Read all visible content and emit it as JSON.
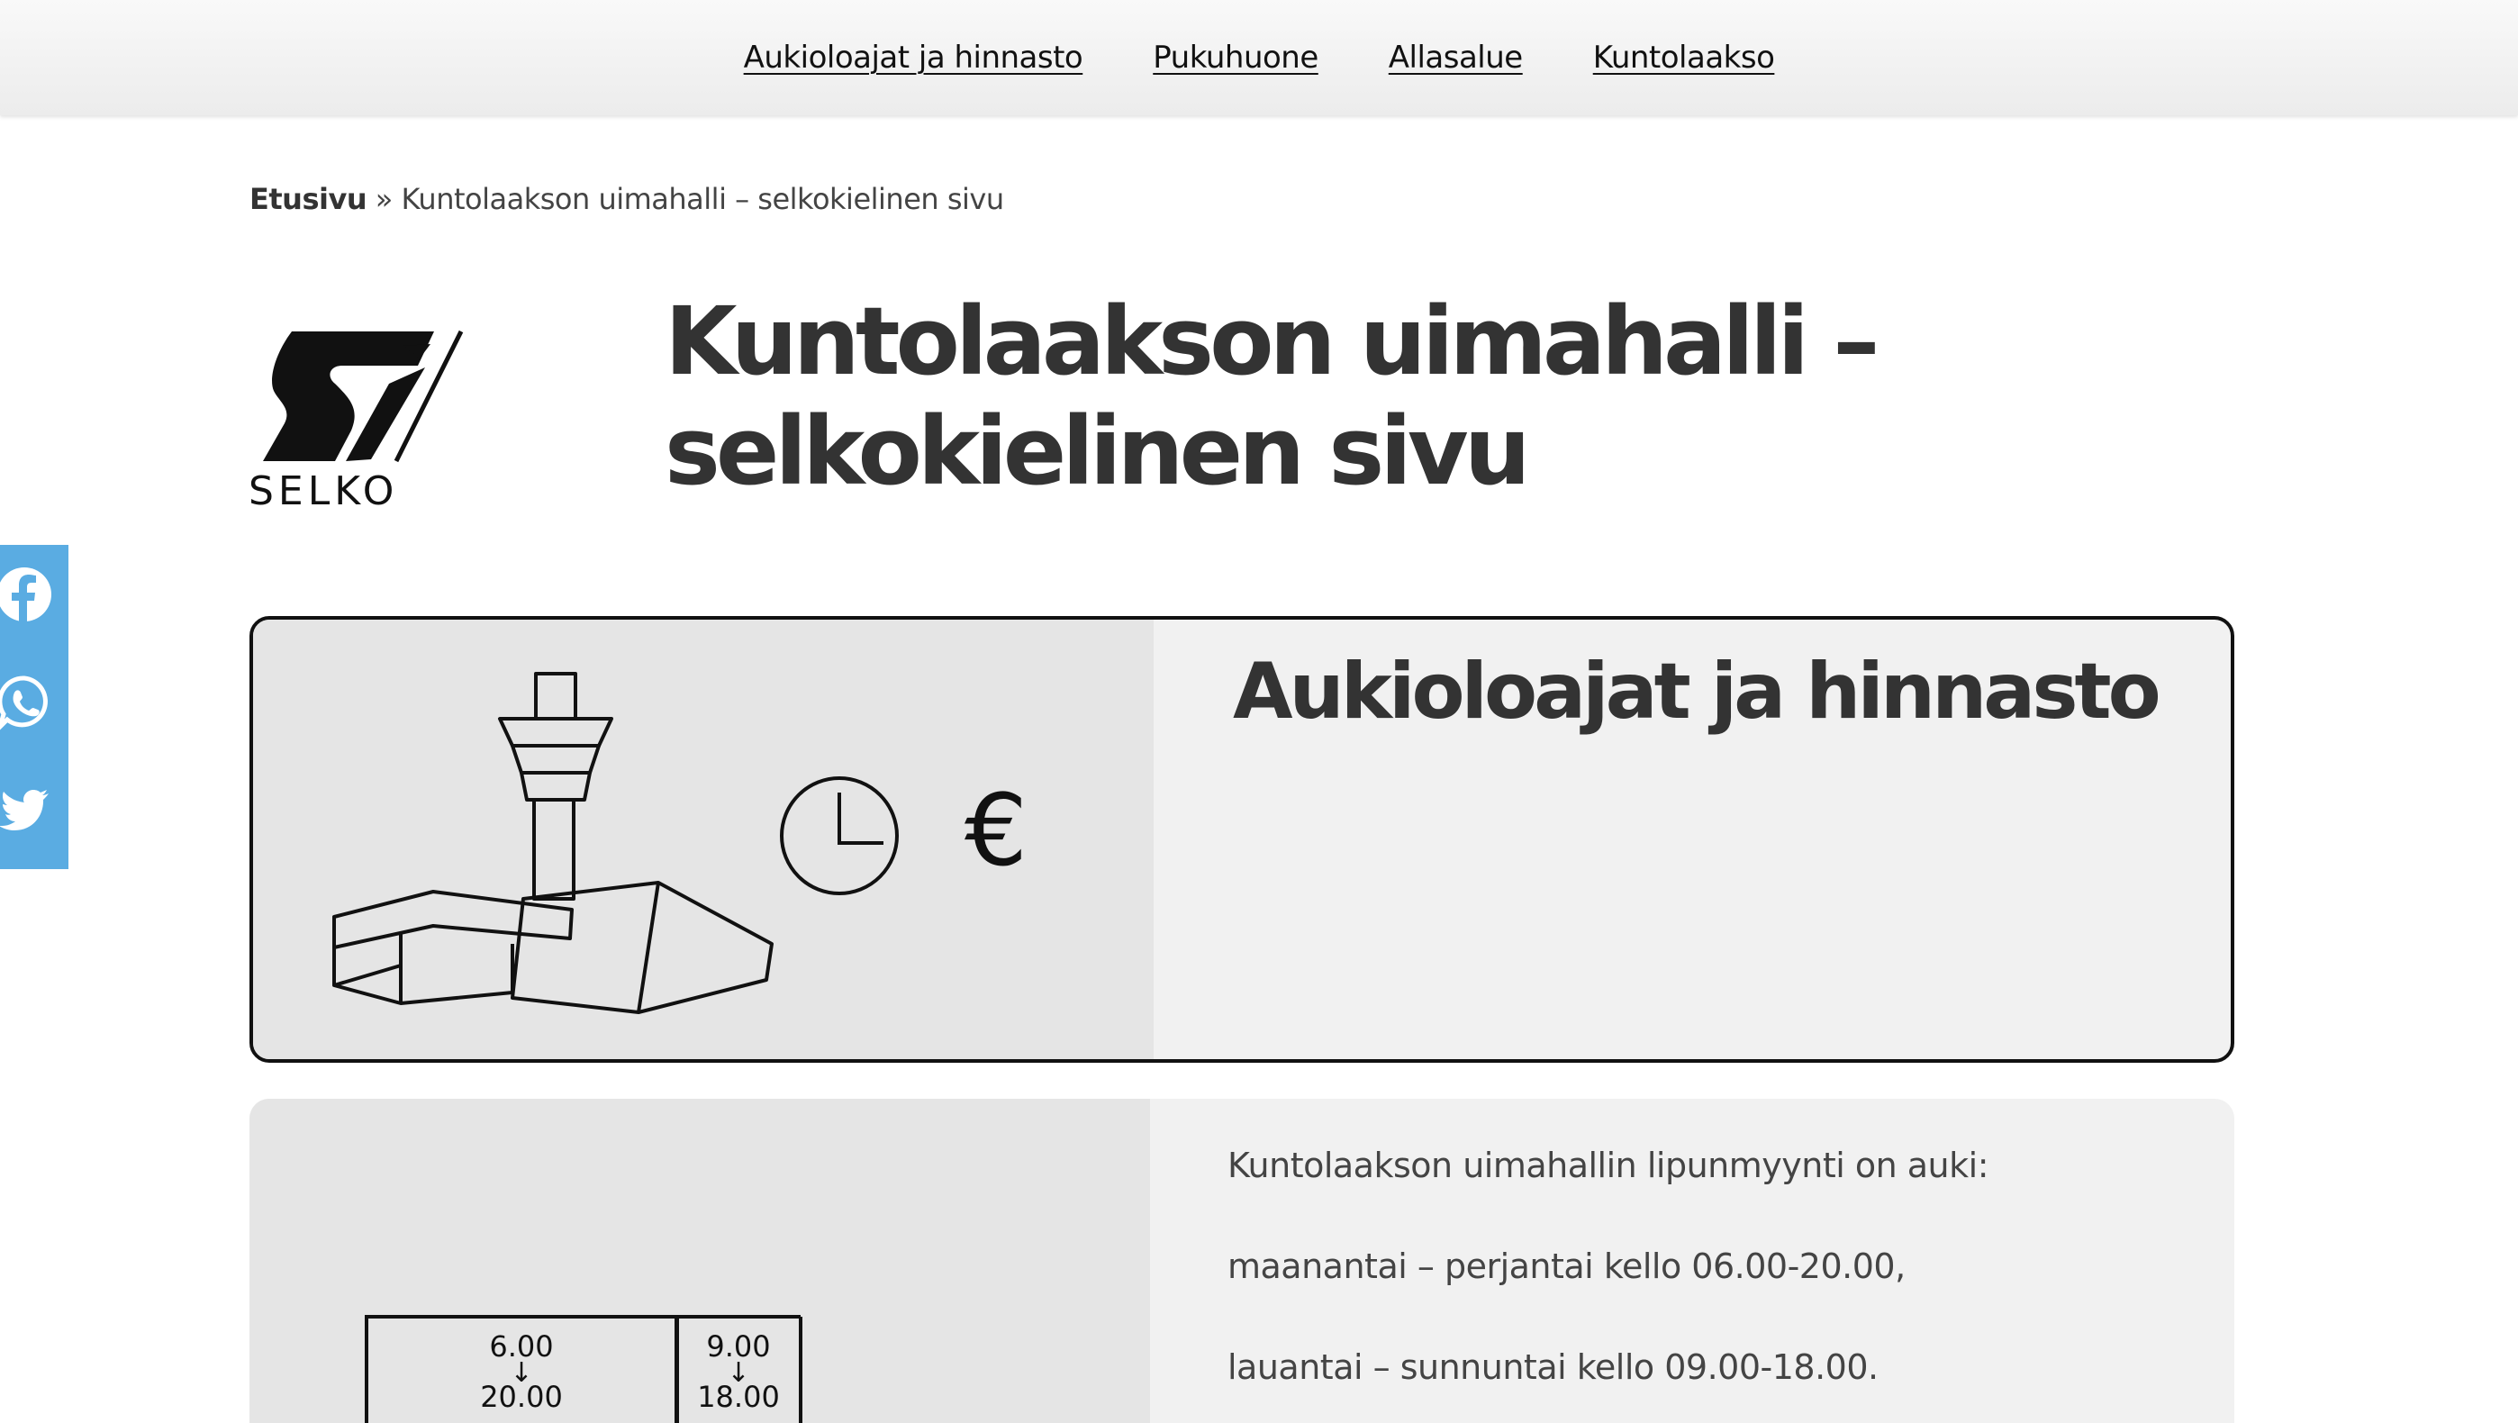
{
  "nav": {
    "items": [
      {
        "label": "Aukioloajat ja hinnasto"
      },
      {
        "label": "Pukuhuone"
      },
      {
        "label": "Allasalue"
      },
      {
        "label": "Kuntolaakso"
      }
    ]
  },
  "breadcrumb": {
    "home": "Etusivu",
    "separator": "»",
    "current": "Kuntolaakson uimahalli – selkokielinen sivu"
  },
  "logo": {
    "text": "SELKO"
  },
  "page": {
    "title": "Kuntolaakson uimahalli – selkokielinen sivu"
  },
  "social": {
    "icons": [
      "facebook-icon",
      "whatsapp-icon",
      "twitter-icon"
    ],
    "color": "#5aace2"
  },
  "card1": {
    "heading": "Aukioloajat ja hinnasto",
    "euro_symbol": "€"
  },
  "card2": {
    "paragraphs": [
      "Kuntolaakson uimahallin lipunmyynti on auki:",
      "maanantai – perjantai kello 06.00-20.00,",
      "lauantai – sunnuntai kello 09.00-18.00."
    ],
    "schedule": [
      {
        "open": "6.00",
        "arrow": "↓",
        "close": "20.00"
      },
      {
        "open": "9.00",
        "arrow": "↓",
        "close": "18.00"
      }
    ]
  },
  "colors": {
    "text": "#333333",
    "card_bg": "#f1f1f1",
    "illustration_bg": "#e5e5e5",
    "social_bg": "#5aace2"
  }
}
